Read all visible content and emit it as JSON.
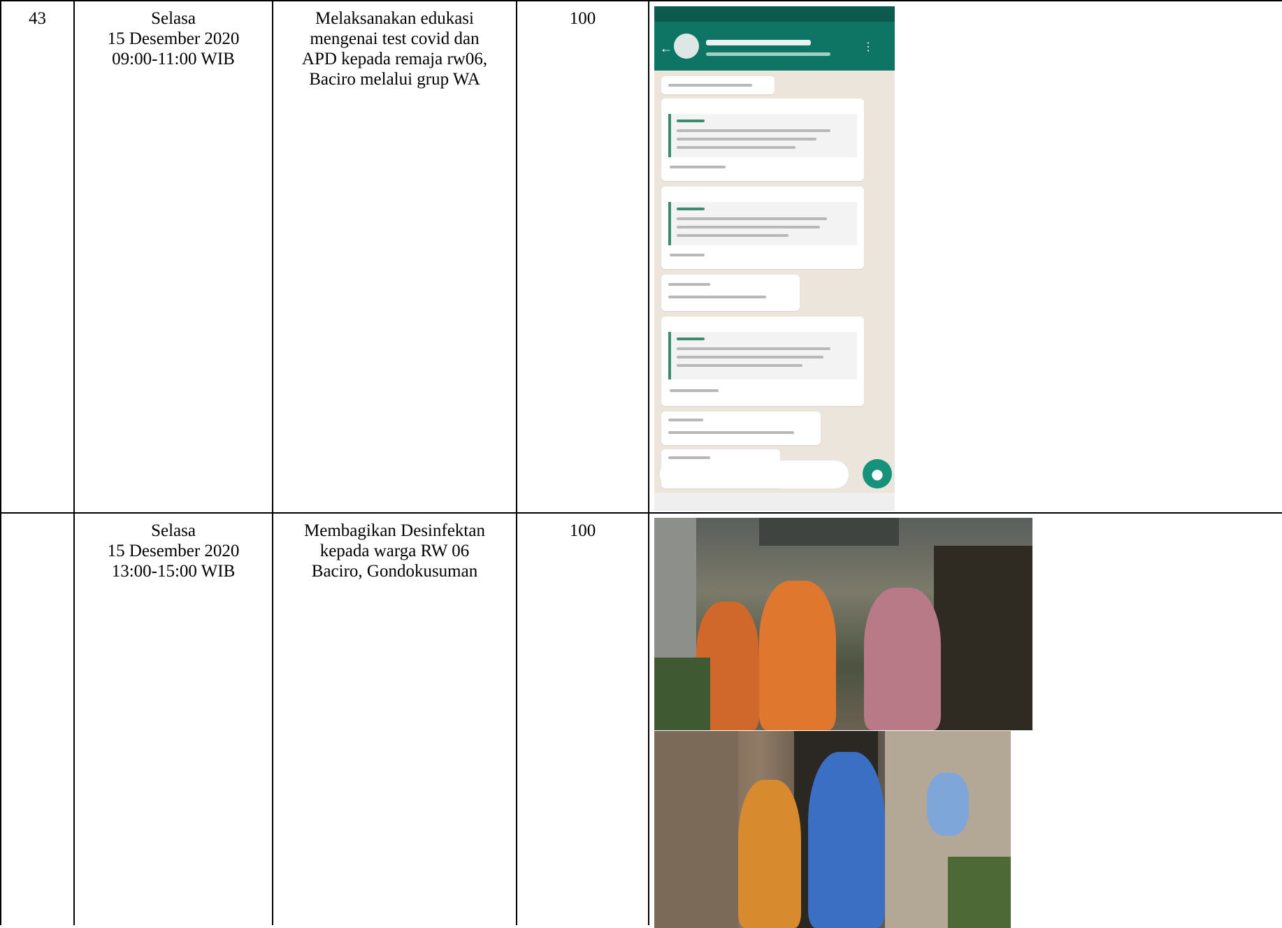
{
  "rows": [
    {
      "no": "43",
      "time": [
        "Selasa",
        "15 Desember 2020",
        "09:00-11:00 WIB"
      ],
      "activity": [
        "Melaksanakan edukasi",
        "mengenai test covid dan",
        "APD kepada remaja rw06,",
        "Baciro melalui grup WA"
      ],
      "score": "100",
      "documentation": "whatsapp-group-screenshot"
    },
    {
      "no": "",
      "time": [
        "Selasa",
        "15 Desember 2020",
        "13:00-15:00 WIB"
      ],
      "activity": [
        "Membagikan Desinfektan",
        "kepada warga RW 06",
        "Baciro, Gondokusuman"
      ],
      "score": "100",
      "documentation": "distribution-photos"
    }
  ]
}
